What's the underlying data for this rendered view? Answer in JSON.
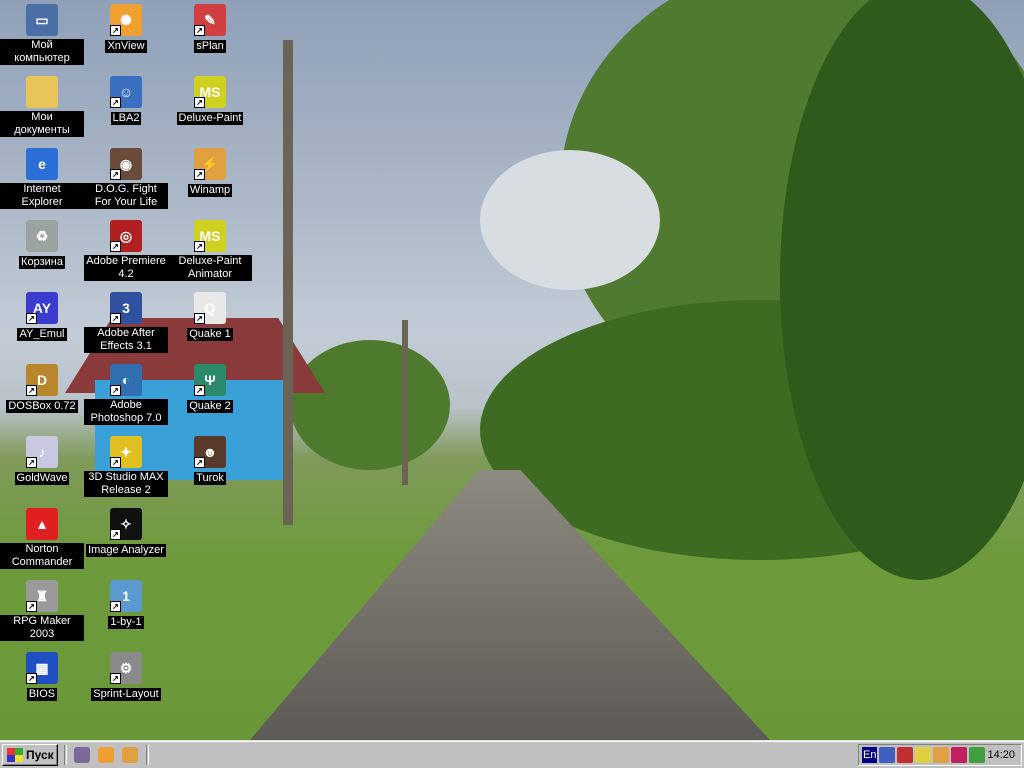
{
  "desktop": {
    "icons": [
      {
        "label": "Мой компьютер",
        "icon": "my-computer-icon",
        "color": "#4a6fa5",
        "glyph": "▭",
        "shortcut": false
      },
      {
        "label": "Мои документы",
        "icon": "folder-icon",
        "color": "#e8c55a",
        "glyph": "",
        "shortcut": false
      },
      {
        "label": "Internet Explorer",
        "icon": "internet-explorer-icon",
        "color": "#2a6fd6",
        "glyph": "e",
        "shortcut": false
      },
      {
        "label": "Корзина",
        "icon": "recycle-bin-icon",
        "color": "#9aa3a0",
        "glyph": "♻",
        "shortcut": false
      },
      {
        "label": "AY_Emul",
        "icon": "ay-emul-icon",
        "color": "#3b3bd0",
        "glyph": "AY",
        "shortcut": true
      },
      {
        "label": "DOSBox 0.72",
        "icon": "dosbox-icon",
        "color": "#b8862d",
        "glyph": "D",
        "shortcut": true
      },
      {
        "label": "GoldWave",
        "icon": "goldwave-icon",
        "color": "#c8c8e0",
        "glyph": "♪",
        "shortcut": true
      },
      {
        "label": "Norton Commander",
        "icon": "norton-commander-icon",
        "color": "#e02020",
        "glyph": "▲",
        "shortcut": false
      },
      {
        "label": "RPG Maker 2003",
        "icon": "rpg-maker-icon",
        "color": "#9a9a9a",
        "glyph": "♜",
        "shortcut": true
      },
      {
        "label": "BIOS",
        "icon": "bios-icon",
        "color": "#2050c0",
        "glyph": "▦",
        "shortcut": true
      },
      {
        "label": "XnView",
        "icon": "xnview-icon",
        "color": "#f0a030",
        "glyph": "✺",
        "shortcut": true
      },
      {
        "label": "LBA2",
        "icon": "lba2-icon",
        "color": "#3a6fc0",
        "glyph": "☺",
        "shortcut": true
      },
      {
        "label": "D.O.G. Fight For Your Life",
        "icon": "dog-fight-icon",
        "color": "#6a4a3a",
        "glyph": "◉",
        "shortcut": true
      },
      {
        "label": "Adobe Premiere 4.2",
        "icon": "adobe-premiere-icon",
        "color": "#b02020",
        "glyph": "◎",
        "shortcut": true
      },
      {
        "label": "Adobe After Effects 3.1",
        "icon": "adobe-after-effects-icon",
        "color": "#3050a0",
        "glyph": "3",
        "shortcut": true
      },
      {
        "label": "Adobe Photoshop 7.0",
        "icon": "adobe-photoshop-icon",
        "color": "#3070b0",
        "glyph": "◐",
        "shortcut": true
      },
      {
        "label": "3D Studio MAX Release 2",
        "icon": "3d-studio-max-icon",
        "color": "#e0c020",
        "glyph": "✦",
        "shortcut": true
      },
      {
        "label": "Image Analyzer",
        "icon": "image-analyzer-icon",
        "color": "#111111",
        "glyph": "✧",
        "shortcut": true
      },
      {
        "label": "1-by-1",
        "icon": "1-by-1-icon",
        "color": "#5a9ad0",
        "glyph": "1",
        "shortcut": true
      },
      {
        "label": "Sprint-Layout",
        "icon": "sprint-layout-icon",
        "color": "#8a8a8a",
        "glyph": "⚙",
        "shortcut": true
      },
      {
        "label": "sPlan",
        "icon": "splan-icon",
        "color": "#d04040",
        "glyph": "✎",
        "shortcut": true
      },
      {
        "label": "Deluxe-Paint",
        "icon": "deluxe-paint-icon",
        "color": "#d0d020",
        "glyph": "MS",
        "shortcut": true
      },
      {
        "label": "Winamp",
        "icon": "winamp-icon",
        "color": "#e0a040",
        "glyph": "⚡",
        "shortcut": true
      },
      {
        "label": "Deluxe-Paint Animator",
        "icon": "deluxe-paint-animator-icon",
        "color": "#d0d020",
        "glyph": "MS",
        "shortcut": true
      },
      {
        "label": "Quake 1",
        "icon": "quake-1-icon",
        "color": "#e8e8e8",
        "glyph": "Q",
        "shortcut": true
      },
      {
        "label": "Quake 2",
        "icon": "quake-2-icon",
        "color": "#2a8a6a",
        "glyph": "Ψ",
        "shortcut": true
      },
      {
        "label": "Turok",
        "icon": "turok-icon",
        "color": "#5a3a2a",
        "glyph": "☻",
        "shortcut": true
      }
    ]
  },
  "taskbar": {
    "start_label": "Пуск",
    "quick_launch": [
      {
        "icon": "show-desktop-icon",
        "color": "#7a6a9a"
      },
      {
        "icon": "xnview-icon",
        "color": "#f0a030"
      },
      {
        "icon": "winamp-icon",
        "color": "#e0a040"
      }
    ],
    "tray": {
      "language": "En",
      "icons": [
        {
          "icon": "display-settings-icon",
          "color": "#4060c0"
        },
        {
          "icon": "audio-app-icon",
          "color": "#c03030"
        },
        {
          "icon": "volume-icon",
          "color": "#e0d040"
        },
        {
          "icon": "winamp-tray-icon",
          "color": "#e0a040"
        },
        {
          "icon": "network-tray-icon",
          "color": "#c02060"
        },
        {
          "icon": "scanner-tray-icon",
          "color": "#40a040"
        }
      ],
      "clock": "14:20"
    }
  }
}
